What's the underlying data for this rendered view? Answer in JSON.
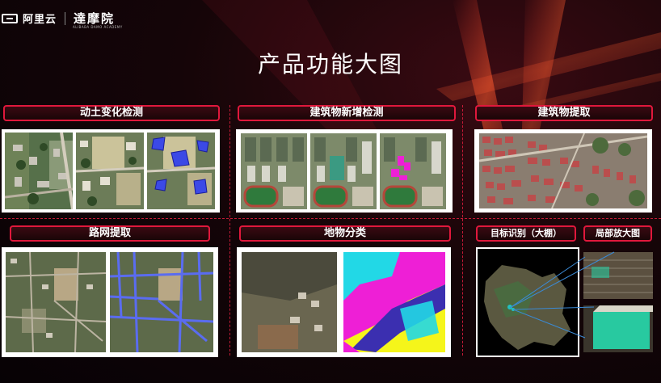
{
  "header": {
    "aliyun_text": "阿里云",
    "damo_text": "達摩院",
    "damo_sub": "ALIBABA DAMO ACADEMY"
  },
  "title": "产品功能大图",
  "sections": {
    "soil_change": {
      "label": "动土变化检测"
    },
    "new_building": {
      "label": "建筑物新增检测"
    },
    "building_extract": {
      "label": "建筑物提取"
    },
    "road_extract": {
      "label": "路网提取"
    },
    "landcover": {
      "label": "地物分类"
    },
    "target": {
      "label": "目标识别（大棚）",
      "zoom_label": "局部放大图"
    }
  },
  "colors": {
    "accent": "#e0183c",
    "cyan": "#22d8e6",
    "magenta": "#ee1fd6",
    "yellow": "#f5f51a",
    "road_blue": "#5a6cf0",
    "greenhouse": "#28c9a0"
  }
}
